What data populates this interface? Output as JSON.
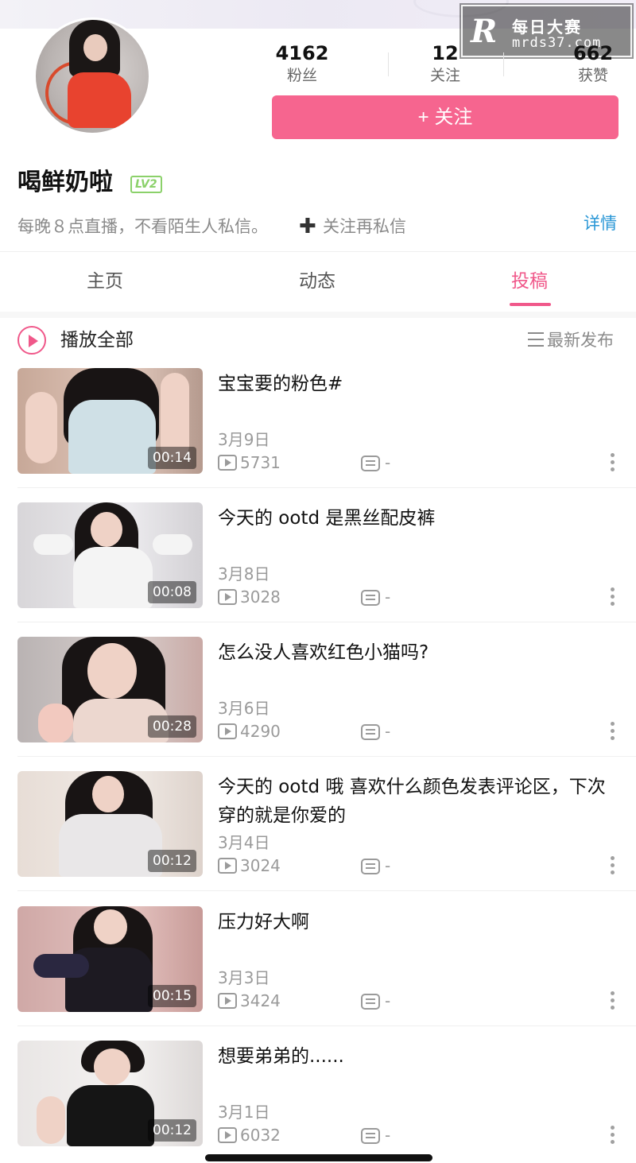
{
  "watermark": {
    "logo": "R",
    "title": "每日大赛",
    "url": "mrds37.com"
  },
  "profile": {
    "stats": [
      {
        "value": "4162",
        "label": "粉丝"
      },
      {
        "value": "12",
        "label": "关注"
      },
      {
        "value": "662",
        "label": "获赞"
      }
    ],
    "follow_button": "+ 关注",
    "username": "喝鲜奶啦",
    "level": "LV2",
    "bio": "每晚８点直播，不看陌生人私信。",
    "bio_follow_plus": "✚",
    "bio_follow_text": "关注再私信",
    "details_link": "详情"
  },
  "tabs": [
    {
      "label": "主页",
      "active": false
    },
    {
      "label": "动态",
      "active": false
    },
    {
      "label": "投稿",
      "active": true
    }
  ],
  "list_header": {
    "play_all": "播放全部",
    "sort": "最新发布"
  },
  "videos": [
    {
      "title": "宝宝要的粉色#",
      "date": "3月9日",
      "plays": "5731",
      "comments": "-",
      "duration": "00:14"
    },
    {
      "title": "今天的 ootd 是黑丝配皮裤",
      "date": "3月8日",
      "plays": "3028",
      "comments": "-",
      "duration": "00:08"
    },
    {
      "title": "怎么没人喜欢红色小猫吗?",
      "date": "3月6日",
      "plays": "4290",
      "comments": "-",
      "duration": "00:28"
    },
    {
      "title": "今天的 ootd 哦 喜欢什么颜色发表评论区，下次穿的就是你爱的",
      "date": "3月4日",
      "plays": "3024",
      "comments": "-",
      "duration": "00:12"
    },
    {
      "title": "压力好大啊",
      "date": "3月3日",
      "plays": "3424",
      "comments": "-",
      "duration": "00:15"
    },
    {
      "title": "想要弟弟的......",
      "date": "3月1日",
      "plays": "6032",
      "comments": "-",
      "duration": "00:12"
    }
  ],
  "colors": {
    "accent": "#f0588a",
    "follow_button": "#f6658f",
    "link": "#2a97d6",
    "level_badge": "#8bd16a"
  }
}
